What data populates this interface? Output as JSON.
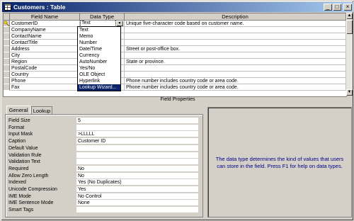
{
  "window": {
    "title": "Customers : Table"
  },
  "grid": {
    "headers": [
      "Field Name",
      "Data Type",
      "Description"
    ],
    "rows": [
      {
        "field": "CustomerID",
        "type": "Text",
        "desc": "Unique five-character code based on customer name."
      },
      {
        "field": "CompanyName",
        "type": "",
        "desc": ""
      },
      {
        "field": "ContactName",
        "type": "",
        "desc": ""
      },
      {
        "field": "ContactTitle",
        "type": "",
        "desc": ""
      },
      {
        "field": "Address",
        "type": "",
        "desc": "Street or post-office box."
      },
      {
        "field": "City",
        "type": "",
        "desc": ""
      },
      {
        "field": "Region",
        "type": "",
        "desc": "State or province."
      },
      {
        "field": "PostalCode",
        "type": "",
        "desc": ""
      },
      {
        "field": "Country",
        "type": "",
        "desc": ""
      },
      {
        "field": "Phone",
        "type": "",
        "desc": "Phone number includes country code or area code."
      },
      {
        "field": "Fax",
        "type": "",
        "desc": "Phone number includes country code or area code."
      }
    ]
  },
  "dropdown": {
    "options": [
      "Text",
      "Memo",
      "Number",
      "Date/Time",
      "Currency",
      "AutoNumber",
      "Yes/No",
      "OLE Object",
      "Hyperlink",
      "Lookup Wizard..."
    ],
    "highlighted": "Lookup Wizard..."
  },
  "field_properties": {
    "title": "Field Properties",
    "tabs": [
      "General",
      "Lookup"
    ],
    "active_tab": "General",
    "rows": [
      {
        "label": "Field Size",
        "value": "5"
      },
      {
        "label": "Format",
        "value": ""
      },
      {
        "label": "Input Mask",
        "value": ">LLLLL"
      },
      {
        "label": "Caption",
        "value": "Customer ID"
      },
      {
        "label": "Default Value",
        "value": ""
      },
      {
        "label": "Validation Rule",
        "value": ""
      },
      {
        "label": "Validation Text",
        "value": ""
      },
      {
        "label": "Required",
        "value": "No"
      },
      {
        "label": "Allow Zero Length",
        "value": "No"
      },
      {
        "label": "Indexed",
        "value": "Yes (No Duplicates)"
      },
      {
        "label": "Unicode Compression",
        "value": "Yes"
      },
      {
        "label": "IME Mode",
        "value": "No Control"
      },
      {
        "label": "IME Sentence Mode",
        "value": "None"
      },
      {
        "label": "Smart Tags",
        "value": ""
      }
    ]
  },
  "help_text": "The data type determines the kind of values that users can store in the field.  Press F1 for help on data types.",
  "colors": {
    "title_start": "#0a246a",
    "title_end": "#a6caf0",
    "highlight": "#0a246a",
    "help_text": "#00008b"
  },
  "icons": {
    "app": "table-icon",
    "key": "primary-key-icon"
  }
}
